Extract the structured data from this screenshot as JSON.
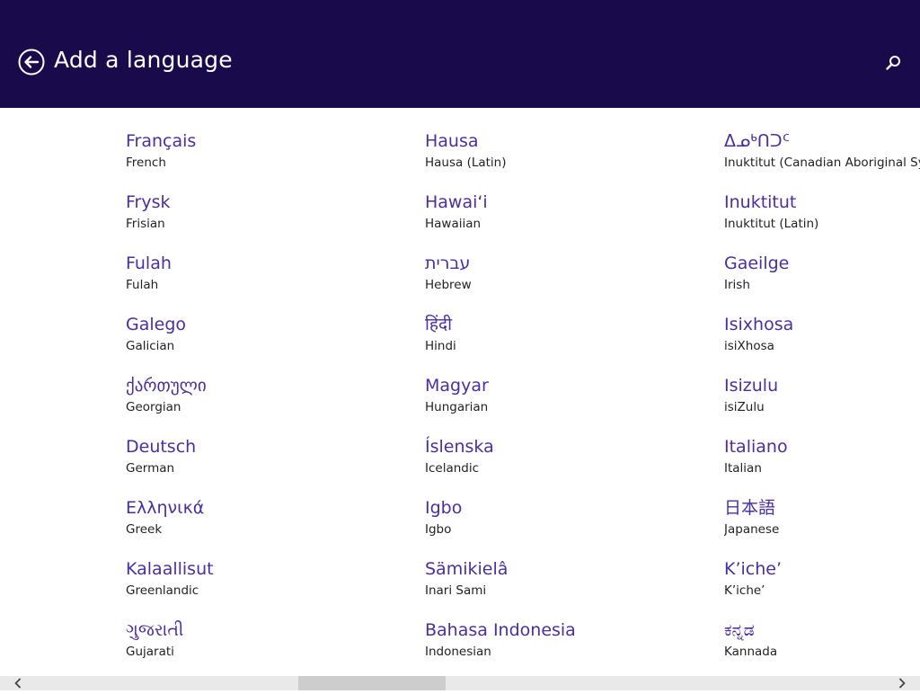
{
  "header": {
    "title": "Add a language",
    "back_icon": "back-arrow-icon",
    "search_icon": "search-icon"
  },
  "colors": {
    "header_bg": "#180a4b",
    "native_text": "#4a2fa0",
    "english_text": "#222222",
    "scrollbar_track": "#e9e9e9",
    "scrollbar_thumb": "#cdcdcd"
  },
  "columns": [
    {
      "items": [
        {
          "native": "Français",
          "english": "French"
        },
        {
          "native": "Frysk",
          "english": "Frisian"
        },
        {
          "native": "Fulah",
          "english": "Fulah"
        },
        {
          "native": "Galego",
          "english": "Galician"
        },
        {
          "native": "ქართული",
          "english": "Georgian"
        },
        {
          "native": "Deutsch",
          "english": "German"
        },
        {
          "native": "Ελληνικά",
          "english": "Greek"
        },
        {
          "native": "Kalaallisut",
          "english": "Greenlandic"
        },
        {
          "native": "ગુજરાતી",
          "english": "Gujarati"
        }
      ]
    },
    {
      "items": [
        {
          "native": "Hausa",
          "english": "Hausa (Latin)"
        },
        {
          "native": "Hawaiʻi",
          "english": "Hawaiian"
        },
        {
          "native": "עברית",
          "english": "Hebrew"
        },
        {
          "native": "हिंदी",
          "english": "Hindi"
        },
        {
          "native": "Magyar",
          "english": "Hungarian"
        },
        {
          "native": "Íslenska",
          "english": "Icelandic"
        },
        {
          "native": "Igbo",
          "english": "Igbo"
        },
        {
          "native": "Sämikielâ",
          "english": "Inari Sami"
        },
        {
          "native": "Bahasa Indonesia",
          "english": "Indonesian"
        }
      ]
    },
    {
      "items": [
        {
          "native": "ᐃᓄᒃᑎᑐᑦ",
          "english": "Inuktitut (Canadian Aboriginal Sylla"
        },
        {
          "native": "Inuktitut",
          "english": "Inuktitut (Latin)"
        },
        {
          "native": "Gaeilge",
          "english": "Irish"
        },
        {
          "native": "Isixhosa",
          "english": "isiXhosa"
        },
        {
          "native": "Isizulu",
          "english": "isiZulu"
        },
        {
          "native": "Italiano",
          "english": "Italian"
        },
        {
          "native": "日本語",
          "english": "Japanese"
        },
        {
          "native": "K’iche’",
          "english": "K’iche’"
        },
        {
          "native": "ಕನ್ನಡ",
          "english": "Kannada"
        }
      ]
    }
  ],
  "scrollbar": {
    "position": 0.4,
    "left_icon": "chevron-left-icon",
    "right_icon": "chevron-right-icon"
  }
}
